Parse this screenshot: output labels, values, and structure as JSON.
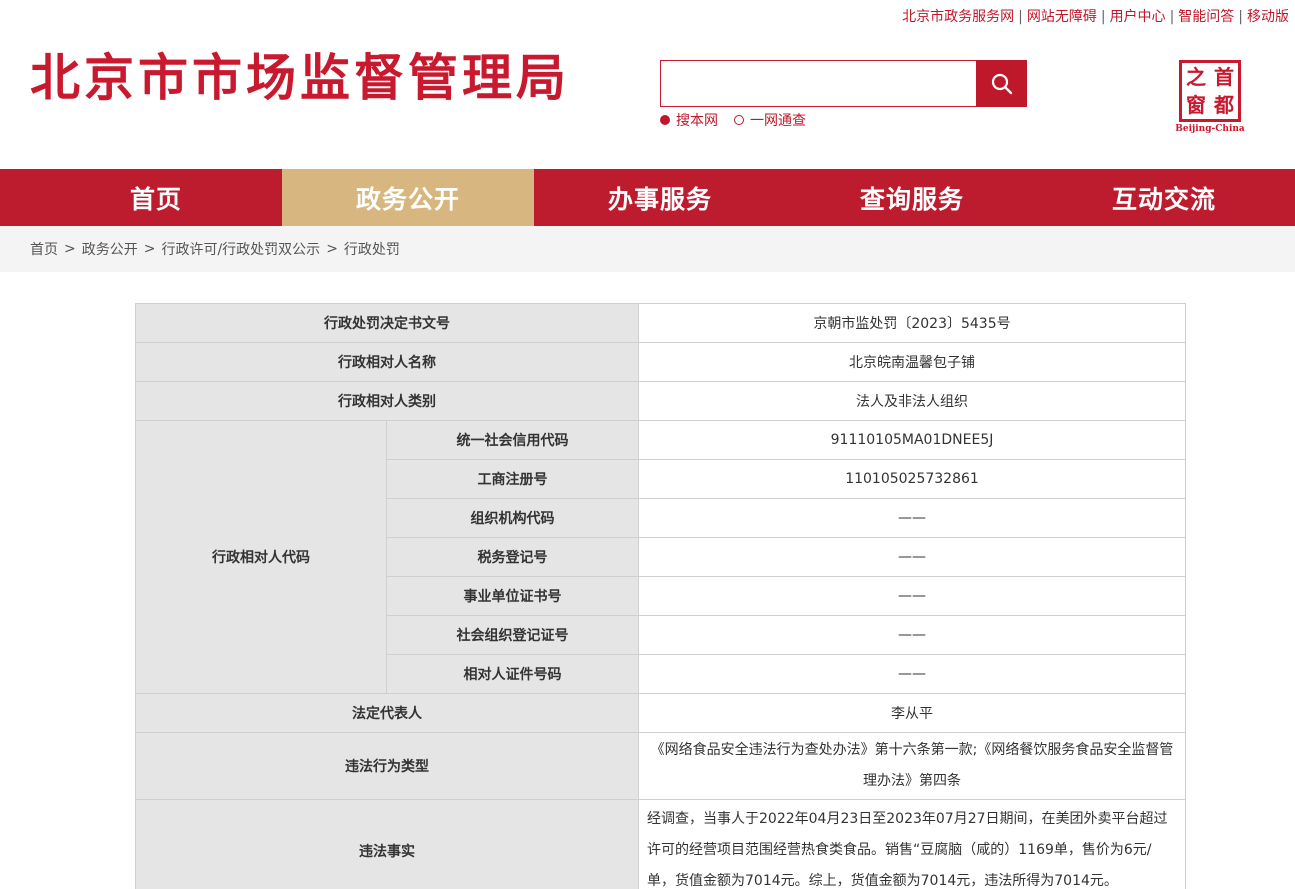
{
  "top_links": [
    "北京市政务服务网",
    "网站无障碍",
    "用户中心",
    "智能问答",
    "移动版"
  ],
  "site_title": "北京市市场监督管理局",
  "search": {
    "placeholder": "",
    "options": [
      "搜本网",
      "一网通查"
    ],
    "selected_option": "搜本网"
  },
  "logo": {
    "chars": [
      "之",
      "首",
      "窗",
      "都"
    ],
    "caption": "Beijing-China"
  },
  "nav": {
    "items": [
      "首页",
      "政务公开",
      "办事服务",
      "查询服务",
      "互动交流"
    ],
    "active": "政务公开"
  },
  "breadcrumb": [
    "首页",
    "政务公开",
    "行政许可/行政处罚双公示",
    "行政处罚"
  ],
  "table": {
    "doc_no_label": "行政处罚决定书文号",
    "doc_no": "京朝市监处罚〔2023〕5435号",
    "party_name_label": "行政相对人名称",
    "party_name": "北京皖南温馨包子铺",
    "party_type_label": "行政相对人类别",
    "party_type": "法人及非法人组织",
    "code_group_label": "行政相对人代码",
    "codes": [
      {
        "label": "统一社会信用代码",
        "value": "91110105MA01DNEE5J"
      },
      {
        "label": "工商注册号",
        "value": "110105025732861"
      },
      {
        "label": "组织机构代码",
        "value": "——"
      },
      {
        "label": "税务登记号",
        "value": "——"
      },
      {
        "label": "事业单位证书号",
        "value": "——"
      },
      {
        "label": "社会组织登记证号",
        "value": "——"
      },
      {
        "label": "相对人证件号码",
        "value": "——"
      }
    ],
    "legal_rep_label": "法定代表人",
    "legal_rep": "李从平",
    "violation_type_label": "违法行为类型",
    "violation_type": "《网络食品安全违法行为查处办法》第十六条第一款;《网络餐饮服务食品安全监督管理办法》第四条",
    "violation_fact_label": "违法事实",
    "violation_fact": "经调查，当事人于2022年04月23日至2023年07月27日期间，在美团外卖平台超过许可的经营项目范围经营热食类食品。销售“豆腐脑（咸的）1169单，售价为6元/单，货值金额为7014元。综上，货值金额为7014元，违法所得为7014元。"
  }
}
